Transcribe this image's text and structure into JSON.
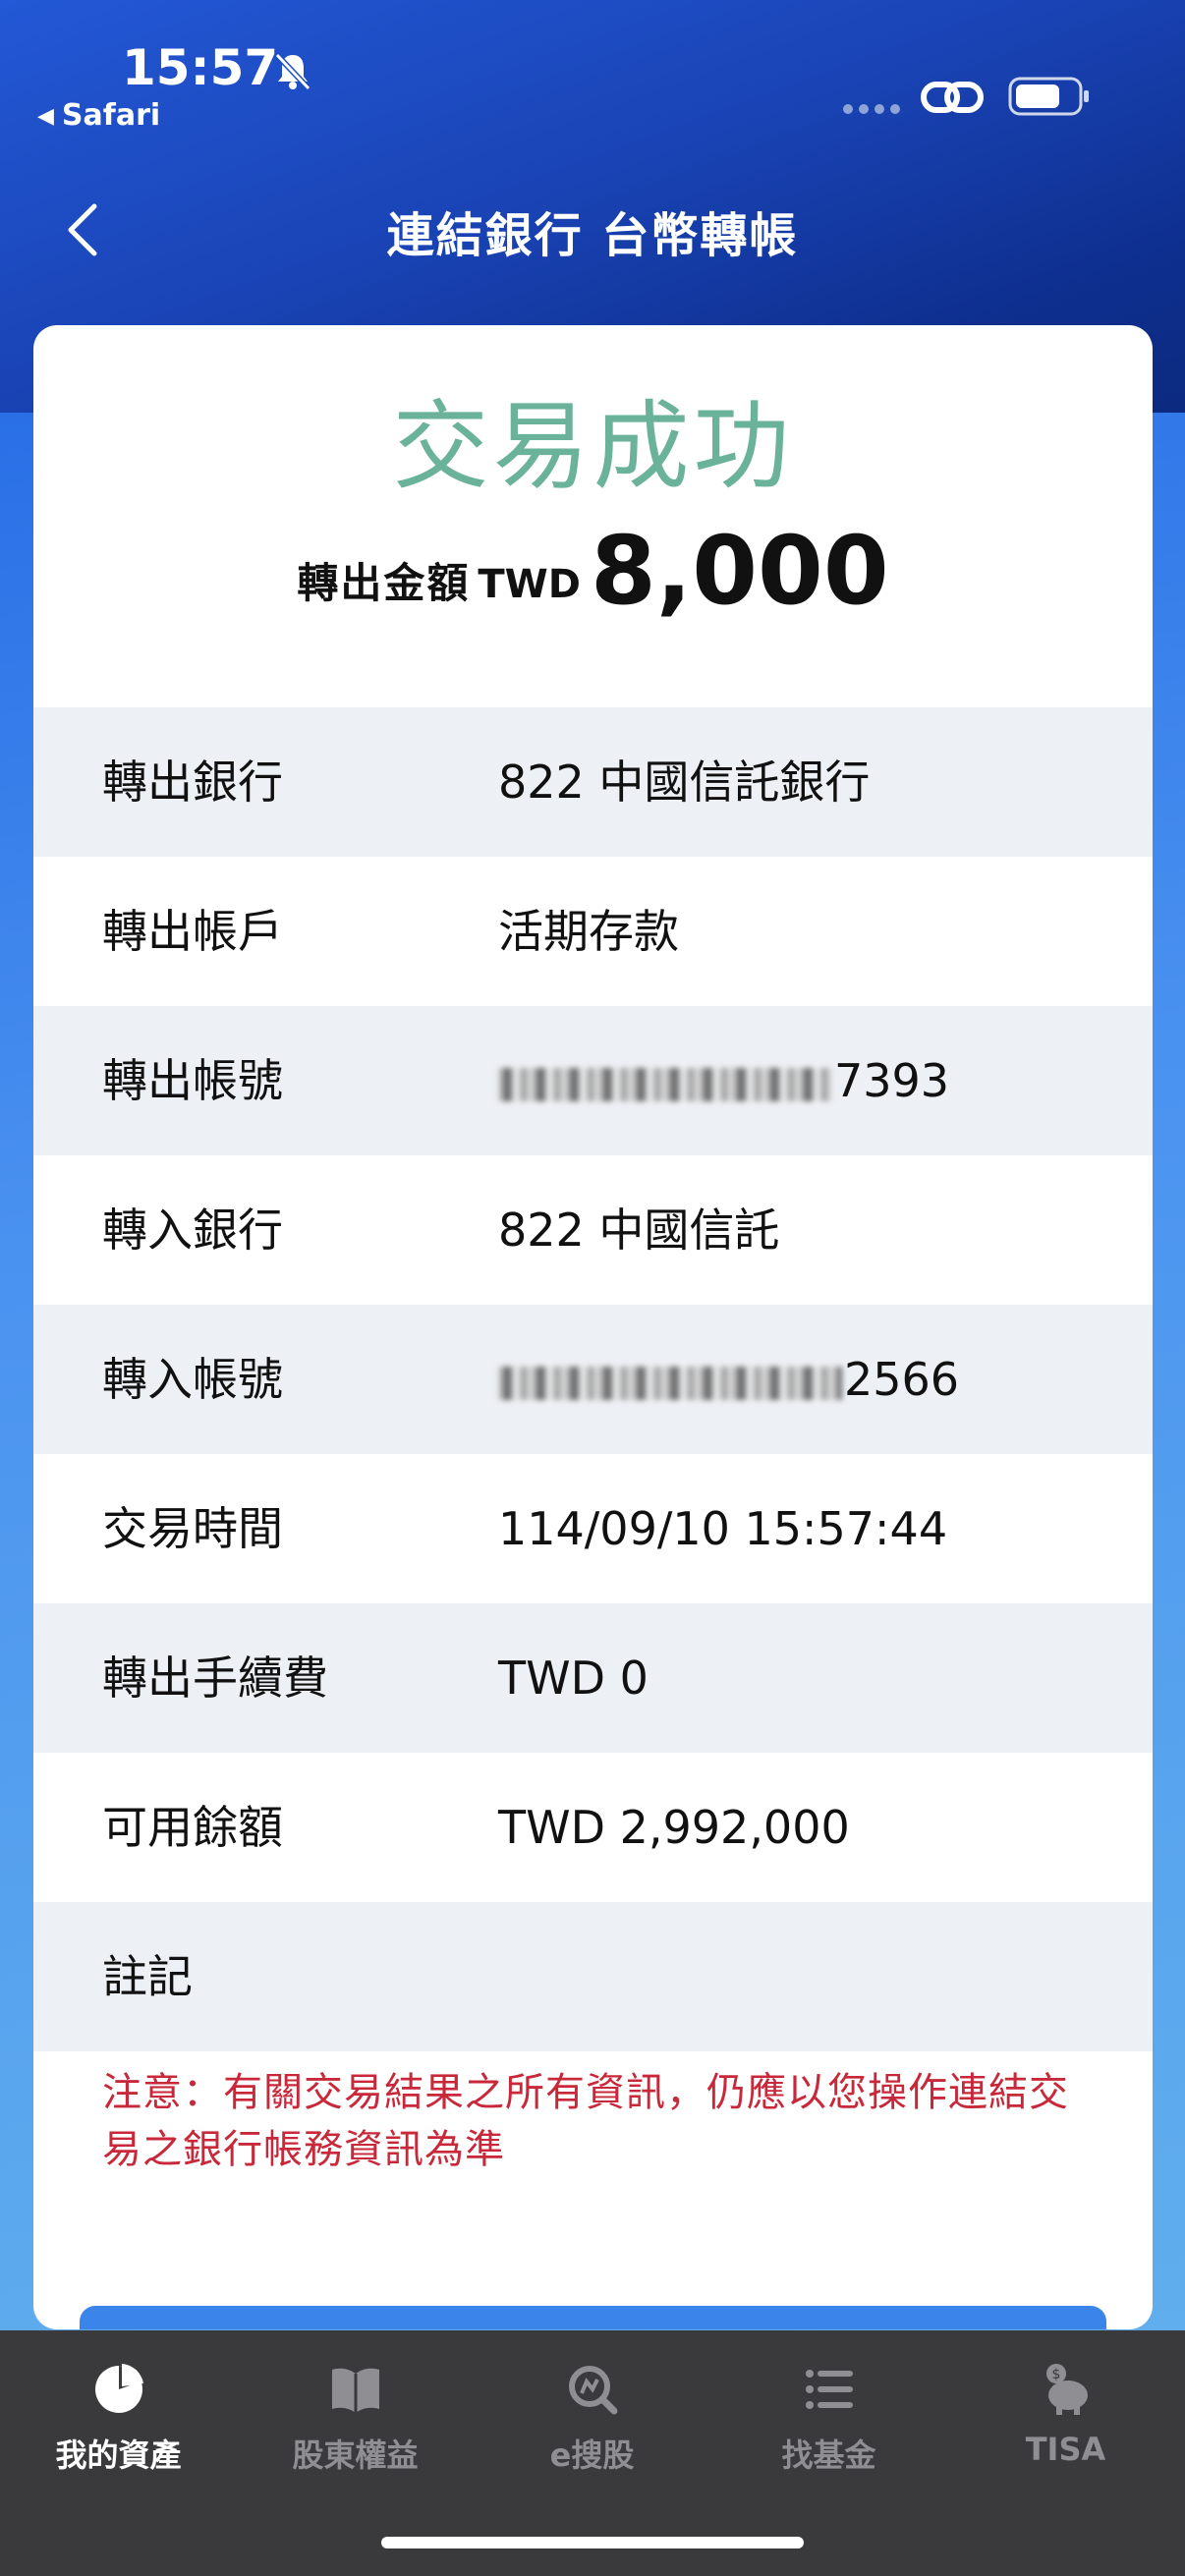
{
  "status_bar": {
    "time": "15:57",
    "back_app": "Safari"
  },
  "nav": {
    "title": "連結銀行 台幣轉帳"
  },
  "result": {
    "title": "交易成功",
    "amount_label": "轉出金額",
    "currency": "TWD",
    "amount": "8,000"
  },
  "details": [
    {
      "label": "轉出銀行",
      "value": "822 中國信託銀行",
      "masked": false
    },
    {
      "label": "轉出帳戶",
      "value": "活期存款",
      "masked": false
    },
    {
      "label": "轉出帳號",
      "value": "7393",
      "masked": true
    },
    {
      "label": "轉入銀行",
      "value": "822 中國信託",
      "masked": false
    },
    {
      "label": "轉入帳號",
      "value": "2566",
      "masked": true
    },
    {
      "label": "交易時間",
      "value": "114/09/10 15:57:44",
      "masked": false
    },
    {
      "label": "轉出手續費",
      "value": "TWD 0",
      "masked": false
    },
    {
      "label": "可用餘額",
      "value": "TWD 2,992,000",
      "masked": false
    },
    {
      "label": "註記",
      "value": "",
      "masked": false
    }
  ],
  "notice": "注意：有關交易結果之所有資訊，仍應以您操作連結交易之銀行帳務資訊為準",
  "tabbar": [
    {
      "label": "我的資產",
      "icon": "pie-chart-icon",
      "active": true
    },
    {
      "label": "股東權益",
      "icon": "book-icon",
      "active": false
    },
    {
      "label": "e搜股",
      "icon": "stock-search-icon",
      "active": false
    },
    {
      "label": "找基金",
      "icon": "list-icon",
      "active": false
    },
    {
      "label": "TISA",
      "icon": "piggy-bank-icon",
      "active": false
    }
  ],
  "colors": {
    "success_green": "#6ab29a",
    "notice_red": "#c8283a",
    "header_blue": "#1a44b6",
    "tabbar_bg": "#3a3a3c"
  }
}
